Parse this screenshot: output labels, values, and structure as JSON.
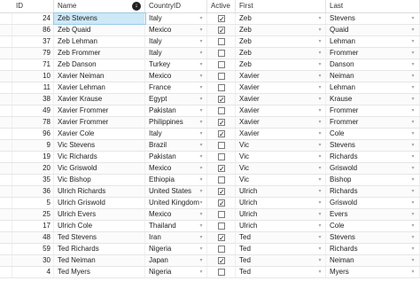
{
  "columns": [
    "ID",
    "Name",
    "CountryID",
    "Active",
    "First",
    "Last"
  ],
  "rows": [
    {
      "id": "24",
      "name": "Zeb Stevens",
      "country": "Italy",
      "active": true,
      "first": "Zeb",
      "last": "Stevens"
    },
    {
      "id": "86",
      "name": "Zeb Quaid",
      "country": "Mexico",
      "active": true,
      "first": "Zeb",
      "last": "Quaid"
    },
    {
      "id": "37",
      "name": "Zeb Lehman",
      "country": "Italy",
      "active": false,
      "first": "Zeb",
      "last": "Lehman"
    },
    {
      "id": "79",
      "name": "Zeb Frommer",
      "country": "Italy",
      "active": false,
      "first": "Zeb",
      "last": "Frommer"
    },
    {
      "id": "71",
      "name": "Zeb Danson",
      "country": "Turkey",
      "active": false,
      "first": "Zeb",
      "last": "Danson"
    },
    {
      "id": "10",
      "name": "Xavier Neiman",
      "country": "Mexico",
      "active": false,
      "first": "Xavier",
      "last": "Neiman"
    },
    {
      "id": "11",
      "name": "Xavier Lehman",
      "country": "France",
      "active": false,
      "first": "Xavier",
      "last": "Lehman"
    },
    {
      "id": "38",
      "name": "Xavier Krause",
      "country": "Egypt",
      "active": true,
      "first": "Xavier",
      "last": "Krause"
    },
    {
      "id": "49",
      "name": "Xavier Frommer",
      "country": "Pakistan",
      "active": false,
      "first": "Xavier",
      "last": "Frommer"
    },
    {
      "id": "78",
      "name": "Xavier Frommer",
      "country": "Philippines",
      "active": true,
      "first": "Xavier",
      "last": "Frommer"
    },
    {
      "id": "96",
      "name": "Xavier Cole",
      "country": "Italy",
      "active": true,
      "first": "Xavier",
      "last": "Cole"
    },
    {
      "id": "9",
      "name": "Vic Stevens",
      "country": "Brazil",
      "active": false,
      "first": "Vic",
      "last": "Stevens"
    },
    {
      "id": "19",
      "name": "Vic Richards",
      "country": "Pakistan",
      "active": false,
      "first": "Vic",
      "last": "Richards"
    },
    {
      "id": "20",
      "name": "Vic Griswold",
      "country": "Mexico",
      "active": true,
      "first": "Vic",
      "last": "Griswold"
    },
    {
      "id": "35",
      "name": "Vic Bishop",
      "country": "Ethiopia",
      "active": false,
      "first": "Vic",
      "last": "Bishop"
    },
    {
      "id": "36",
      "name": "Ulrich Richards",
      "country": "United States",
      "active": true,
      "first": "Ulrich",
      "last": "Richards"
    },
    {
      "id": "5",
      "name": "Ulrich Griswold",
      "country": "United Kingdom",
      "active": true,
      "first": "Ulrich",
      "last": "Griswold"
    },
    {
      "id": "25",
      "name": "Ulrich Evers",
      "country": "Mexico",
      "active": false,
      "first": "Ulrich",
      "last": "Evers"
    },
    {
      "id": "17",
      "name": "Ulrich Cole",
      "country": "Thailand",
      "active": false,
      "first": "Ulrich",
      "last": "Cole"
    },
    {
      "id": "48",
      "name": "Ted Stevens",
      "country": "Iran",
      "active": true,
      "first": "Ted",
      "last": "Stevens"
    },
    {
      "id": "59",
      "name": "Ted Richards",
      "country": "Nigeria",
      "active": false,
      "first": "Ted",
      "last": "Richards"
    },
    {
      "id": "30",
      "name": "Ted Neiman",
      "country": "Japan",
      "active": true,
      "first": "Ted",
      "last": "Neiman"
    },
    {
      "id": "4",
      "name": "Ted Myers",
      "country": "Nigeria",
      "active": false,
      "first": "Ted",
      "last": "Myers"
    }
  ],
  "selected_row": 0,
  "check_mark": "✓",
  "dropdown_glyph": "▾",
  "sort_glyph": "↓",
  "colors": {
    "selection": "#cde8f6",
    "grid_line": "#e6e6e6"
  }
}
